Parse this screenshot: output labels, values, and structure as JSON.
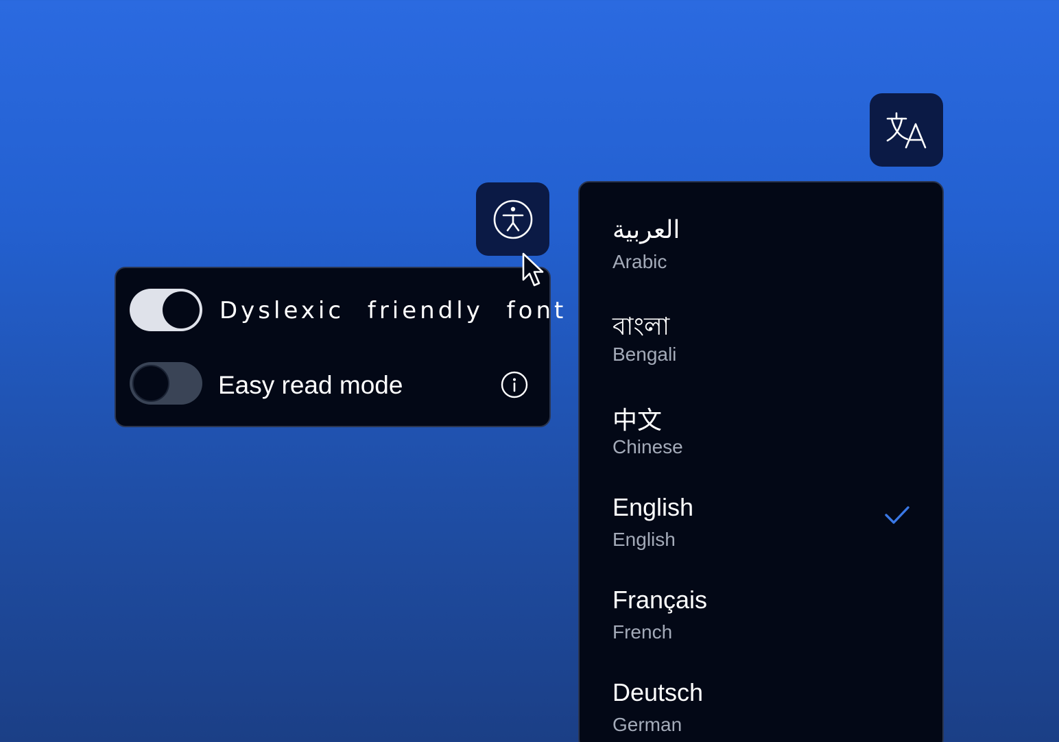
{
  "accessibility_button": {
    "icon": "accessibility-icon"
  },
  "translate_button": {
    "icon": "translate-icon"
  },
  "accessibility_panel": {
    "settings": [
      {
        "label": "Dyslexic friendly font",
        "enabled": true
      },
      {
        "label": "Easy read mode",
        "enabled": false,
        "info_icon": "info-icon"
      }
    ]
  },
  "language_menu": {
    "languages": [
      {
        "native": "العربية",
        "english": "Arabic",
        "selected": false
      },
      {
        "native": "বাংলা",
        "english": "Bengali",
        "selected": false
      },
      {
        "native": "中文",
        "english": "Chinese",
        "selected": false
      },
      {
        "native": "English",
        "english": "English",
        "selected": true
      },
      {
        "native": "Français",
        "english": "French",
        "selected": false
      },
      {
        "native": "Deutsch",
        "english": "German",
        "selected": false
      }
    ],
    "check_icon": "checkmark-icon"
  },
  "colors": {
    "background_top": "#2b6ae0",
    "background_bottom": "#1b3f86",
    "panel": "#030816",
    "button_tile": "#0b1a45",
    "check": "#3a78e6",
    "secondary_text": "#a4abb9"
  }
}
